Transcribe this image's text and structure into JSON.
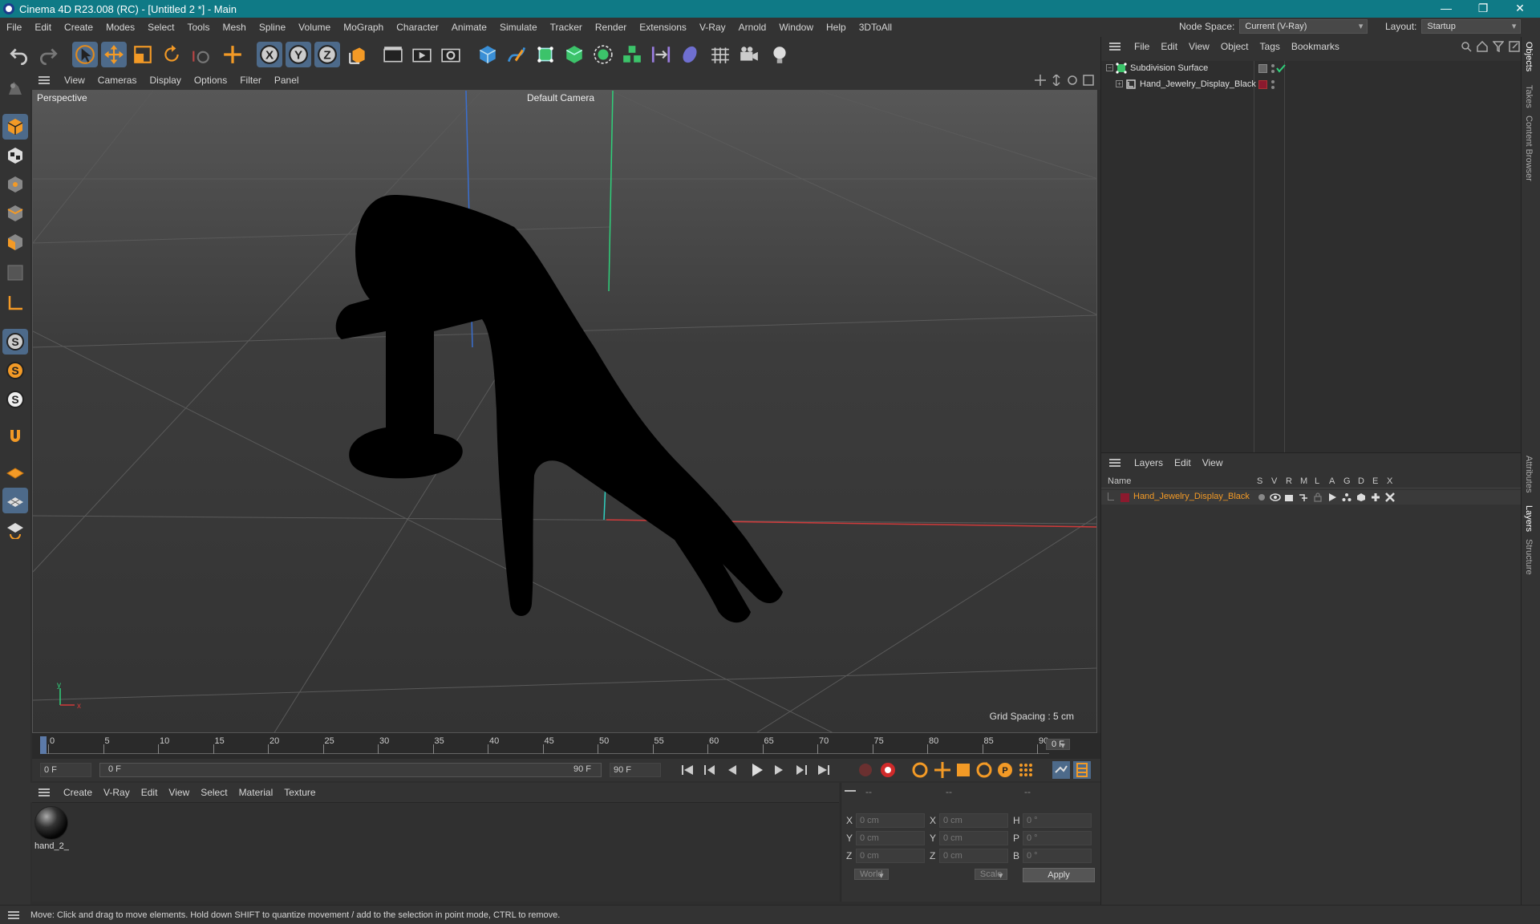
{
  "app": {
    "title": "Cinema 4D R23.008 (RC) - [Untitled 2 *] - Main"
  },
  "window_controls": {
    "minimize": "—",
    "restore": "❐",
    "close": "✕"
  },
  "menubar": {
    "items": [
      "File",
      "Edit",
      "Create",
      "Modes",
      "Select",
      "Tools",
      "Mesh",
      "Spline",
      "Volume",
      "MoGraph",
      "Character",
      "Animate",
      "Simulate",
      "Tracker",
      "Render",
      "Extensions",
      "V-Ray",
      "Arnold",
      "Window",
      "Help",
      "3DToAll"
    ],
    "node_space_label": "Node Space:",
    "node_space_value": "Current (V-Ray)",
    "layout_label": "Layout:",
    "layout_value": "Startup"
  },
  "viewport": {
    "menu": [
      "View",
      "Cameras",
      "Display",
      "Options",
      "Filter",
      "Panel"
    ],
    "name": "Perspective",
    "camera": "Default Camera",
    "grid_spacing": "Grid Spacing : 5 cm",
    "axis_x": "x",
    "axis_y": "y"
  },
  "timeline": {
    "ticks": [
      "0",
      "5",
      "10",
      "15",
      "20",
      "25",
      "30",
      "35",
      "40",
      "45",
      "50",
      "55",
      "60",
      "65",
      "70",
      "75",
      "80",
      "85",
      "90"
    ],
    "current_frame": "0 F"
  },
  "transport": {
    "start_field": "0 F",
    "range_start": "0 F",
    "range_end": "90 F",
    "end_field": "90 F"
  },
  "material_manager": {
    "menu": [
      "Create",
      "V-Ray",
      "Edit",
      "View",
      "Select",
      "Material",
      "Texture"
    ],
    "materials": [
      {
        "name": "hand_2_"
      }
    ]
  },
  "coordinates": {
    "header": [
      "--",
      "--",
      "--"
    ],
    "rows": [
      {
        "l1": "X",
        "v1": "0 cm",
        "l2": "X",
        "v2": "0 cm",
        "l3": "H",
        "v3": "0 °"
      },
      {
        "l1": "Y",
        "v1": "0 cm",
        "l2": "Y",
        "v2": "0 cm",
        "l3": "P",
        "v3": "0 °"
      },
      {
        "l1": "Z",
        "v1": "0 cm",
        "l2": "Z",
        "v2": "0 cm",
        "l3": "B",
        "v3": "0 °"
      }
    ],
    "space": "World",
    "mode": "Scale",
    "apply": "Apply"
  },
  "object_manager": {
    "menu": [
      "File",
      "Edit",
      "View",
      "Object",
      "Tags",
      "Bookmarks"
    ],
    "objects": [
      {
        "name": "Subdivision Surface"
      },
      {
        "name": "Hand_Jewelry_Display_Black"
      }
    ]
  },
  "layer_manager": {
    "menu": [
      "Layers",
      "Edit",
      "View"
    ],
    "columns": {
      "name": "Name",
      "flags": [
        "S",
        "V",
        "R",
        "M",
        "L",
        "A",
        "G",
        "D",
        "E",
        "X"
      ]
    },
    "layers": [
      {
        "name": "Hand_Jewelry_Display_Black",
        "color": "#8b1a2e"
      }
    ]
  },
  "right_tabs": [
    "Objects",
    "Takes",
    "Content Browser",
    "Attributes",
    "Layers",
    "Structure"
  ],
  "status": {
    "text": "Move: Click and drag to move elements. Hold down SHIFT to quantize movement / add to the selection in point mode, CTRL to remove."
  }
}
